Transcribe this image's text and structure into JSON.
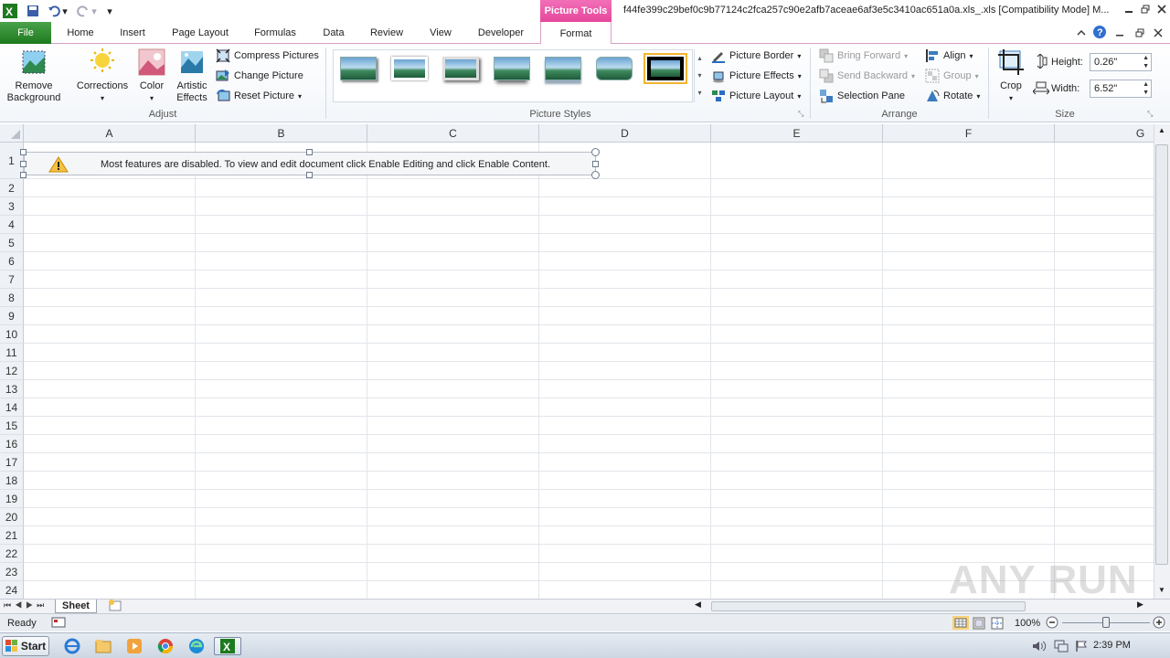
{
  "title_bar": {
    "contextual_tab": "Picture Tools",
    "document_title": "f44fe399c29bef0c9b77124c2fca257c90e2afb7aceae6af3e5c3410ac651a0a.xls_.xls  [Compatibility Mode]  M..."
  },
  "tabs": [
    "File",
    "Home",
    "Insert",
    "Page Layout",
    "Formulas",
    "Data",
    "Review",
    "View",
    "Developer",
    "Format"
  ],
  "ribbon": {
    "adjust": {
      "remove_background": "Remove Background",
      "corrections": "Corrections",
      "color": "Color",
      "artistic_effects": "Artistic Effects",
      "compress": "Compress Pictures",
      "change": "Change Picture",
      "reset": "Reset Picture",
      "label": "Adjust"
    },
    "styles": {
      "label": "Picture Styles",
      "border": "Picture Border",
      "effects": "Picture Effects",
      "layout": "Picture Layout"
    },
    "arrange": {
      "label": "Arrange",
      "bring_forward": "Bring Forward",
      "send_backward": "Send Backward",
      "selection_pane": "Selection Pane",
      "align": "Align",
      "group": "Group",
      "rotate": "Rotate"
    },
    "size": {
      "label": "Size",
      "crop": "Crop",
      "height_label": "Height:",
      "height_value": "0.26\"",
      "width_label": "Width:",
      "width_value": "6.52\""
    }
  },
  "columns": [
    "A",
    "B",
    "C",
    "D",
    "E",
    "F",
    "G"
  ],
  "rows": [
    "1",
    "2",
    "3",
    "4",
    "5",
    "6",
    "7",
    "8",
    "9",
    "10",
    "11",
    "12",
    "13",
    "14",
    "15",
    "16",
    "17",
    "18",
    "19",
    "20",
    "21",
    "22",
    "23",
    "24"
  ],
  "message_bar": {
    "text": "Most features are disabled. To view and edit document click Enable Editing and click Enable Content."
  },
  "sheet_tabs": [
    "Sheet"
  ],
  "status": {
    "ready": "Ready",
    "zoom": "100%"
  },
  "taskbar": {
    "start": "Start",
    "clock": "2:39 PM"
  },
  "watermark": "ANY RUN",
  "colors": {
    "file_tab": "#1e7a1e",
    "picture_tools": "#e6479b"
  }
}
